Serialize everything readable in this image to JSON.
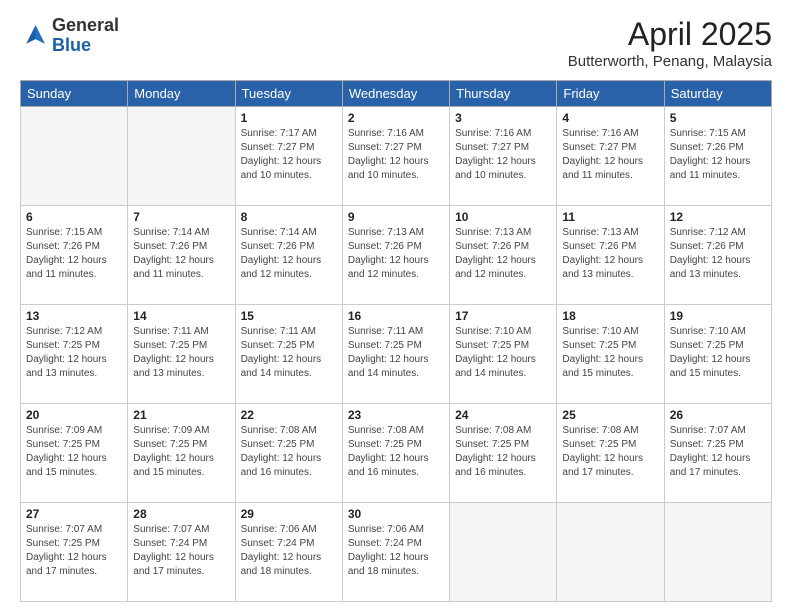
{
  "header": {
    "logo_general": "General",
    "logo_blue": "Blue",
    "title": "April 2025",
    "location": "Butterworth, Penang, Malaysia"
  },
  "weekdays": [
    "Sunday",
    "Monday",
    "Tuesday",
    "Wednesday",
    "Thursday",
    "Friday",
    "Saturday"
  ],
  "weeks": [
    [
      {
        "day": "",
        "sunrise": "",
        "sunset": "",
        "daylight": ""
      },
      {
        "day": "",
        "sunrise": "",
        "sunset": "",
        "daylight": ""
      },
      {
        "day": "1",
        "sunrise": "Sunrise: 7:17 AM",
        "sunset": "Sunset: 7:27 PM",
        "daylight": "Daylight: 12 hours and 10 minutes."
      },
      {
        "day": "2",
        "sunrise": "Sunrise: 7:16 AM",
        "sunset": "Sunset: 7:27 PM",
        "daylight": "Daylight: 12 hours and 10 minutes."
      },
      {
        "day": "3",
        "sunrise": "Sunrise: 7:16 AM",
        "sunset": "Sunset: 7:27 PM",
        "daylight": "Daylight: 12 hours and 10 minutes."
      },
      {
        "day": "4",
        "sunrise": "Sunrise: 7:16 AM",
        "sunset": "Sunset: 7:27 PM",
        "daylight": "Daylight: 12 hours and 11 minutes."
      },
      {
        "day": "5",
        "sunrise": "Sunrise: 7:15 AM",
        "sunset": "Sunset: 7:26 PM",
        "daylight": "Daylight: 12 hours and 11 minutes."
      }
    ],
    [
      {
        "day": "6",
        "sunrise": "Sunrise: 7:15 AM",
        "sunset": "Sunset: 7:26 PM",
        "daylight": "Daylight: 12 hours and 11 minutes."
      },
      {
        "day": "7",
        "sunrise": "Sunrise: 7:14 AM",
        "sunset": "Sunset: 7:26 PM",
        "daylight": "Daylight: 12 hours and 11 minutes."
      },
      {
        "day": "8",
        "sunrise": "Sunrise: 7:14 AM",
        "sunset": "Sunset: 7:26 PM",
        "daylight": "Daylight: 12 hours and 12 minutes."
      },
      {
        "day": "9",
        "sunrise": "Sunrise: 7:13 AM",
        "sunset": "Sunset: 7:26 PM",
        "daylight": "Daylight: 12 hours and 12 minutes."
      },
      {
        "day": "10",
        "sunrise": "Sunrise: 7:13 AM",
        "sunset": "Sunset: 7:26 PM",
        "daylight": "Daylight: 12 hours and 12 minutes."
      },
      {
        "day": "11",
        "sunrise": "Sunrise: 7:13 AM",
        "sunset": "Sunset: 7:26 PM",
        "daylight": "Daylight: 12 hours and 13 minutes."
      },
      {
        "day": "12",
        "sunrise": "Sunrise: 7:12 AM",
        "sunset": "Sunset: 7:26 PM",
        "daylight": "Daylight: 12 hours and 13 minutes."
      }
    ],
    [
      {
        "day": "13",
        "sunrise": "Sunrise: 7:12 AM",
        "sunset": "Sunset: 7:25 PM",
        "daylight": "Daylight: 12 hours and 13 minutes."
      },
      {
        "day": "14",
        "sunrise": "Sunrise: 7:11 AM",
        "sunset": "Sunset: 7:25 PM",
        "daylight": "Daylight: 12 hours and 13 minutes."
      },
      {
        "day": "15",
        "sunrise": "Sunrise: 7:11 AM",
        "sunset": "Sunset: 7:25 PM",
        "daylight": "Daylight: 12 hours and 14 minutes."
      },
      {
        "day": "16",
        "sunrise": "Sunrise: 7:11 AM",
        "sunset": "Sunset: 7:25 PM",
        "daylight": "Daylight: 12 hours and 14 minutes."
      },
      {
        "day": "17",
        "sunrise": "Sunrise: 7:10 AM",
        "sunset": "Sunset: 7:25 PM",
        "daylight": "Daylight: 12 hours and 14 minutes."
      },
      {
        "day": "18",
        "sunrise": "Sunrise: 7:10 AM",
        "sunset": "Sunset: 7:25 PM",
        "daylight": "Daylight: 12 hours and 15 minutes."
      },
      {
        "day": "19",
        "sunrise": "Sunrise: 7:10 AM",
        "sunset": "Sunset: 7:25 PM",
        "daylight": "Daylight: 12 hours and 15 minutes."
      }
    ],
    [
      {
        "day": "20",
        "sunrise": "Sunrise: 7:09 AM",
        "sunset": "Sunset: 7:25 PM",
        "daylight": "Daylight: 12 hours and 15 minutes."
      },
      {
        "day": "21",
        "sunrise": "Sunrise: 7:09 AM",
        "sunset": "Sunset: 7:25 PM",
        "daylight": "Daylight: 12 hours and 15 minutes."
      },
      {
        "day": "22",
        "sunrise": "Sunrise: 7:08 AM",
        "sunset": "Sunset: 7:25 PM",
        "daylight": "Daylight: 12 hours and 16 minutes."
      },
      {
        "day": "23",
        "sunrise": "Sunrise: 7:08 AM",
        "sunset": "Sunset: 7:25 PM",
        "daylight": "Daylight: 12 hours and 16 minutes."
      },
      {
        "day": "24",
        "sunrise": "Sunrise: 7:08 AM",
        "sunset": "Sunset: 7:25 PM",
        "daylight": "Daylight: 12 hours and 16 minutes."
      },
      {
        "day": "25",
        "sunrise": "Sunrise: 7:08 AM",
        "sunset": "Sunset: 7:25 PM",
        "daylight": "Daylight: 12 hours and 17 minutes."
      },
      {
        "day": "26",
        "sunrise": "Sunrise: 7:07 AM",
        "sunset": "Sunset: 7:25 PM",
        "daylight": "Daylight: 12 hours and 17 minutes."
      }
    ],
    [
      {
        "day": "27",
        "sunrise": "Sunrise: 7:07 AM",
        "sunset": "Sunset: 7:25 PM",
        "daylight": "Daylight: 12 hours and 17 minutes."
      },
      {
        "day": "28",
        "sunrise": "Sunrise: 7:07 AM",
        "sunset": "Sunset: 7:24 PM",
        "daylight": "Daylight: 12 hours and 17 minutes."
      },
      {
        "day": "29",
        "sunrise": "Sunrise: 7:06 AM",
        "sunset": "Sunset: 7:24 PM",
        "daylight": "Daylight: 12 hours and 18 minutes."
      },
      {
        "day": "30",
        "sunrise": "Sunrise: 7:06 AM",
        "sunset": "Sunset: 7:24 PM",
        "daylight": "Daylight: 12 hours and 18 minutes."
      },
      {
        "day": "",
        "sunrise": "",
        "sunset": "",
        "daylight": ""
      },
      {
        "day": "",
        "sunrise": "",
        "sunset": "",
        "daylight": ""
      },
      {
        "day": "",
        "sunrise": "",
        "sunset": "",
        "daylight": ""
      }
    ]
  ]
}
